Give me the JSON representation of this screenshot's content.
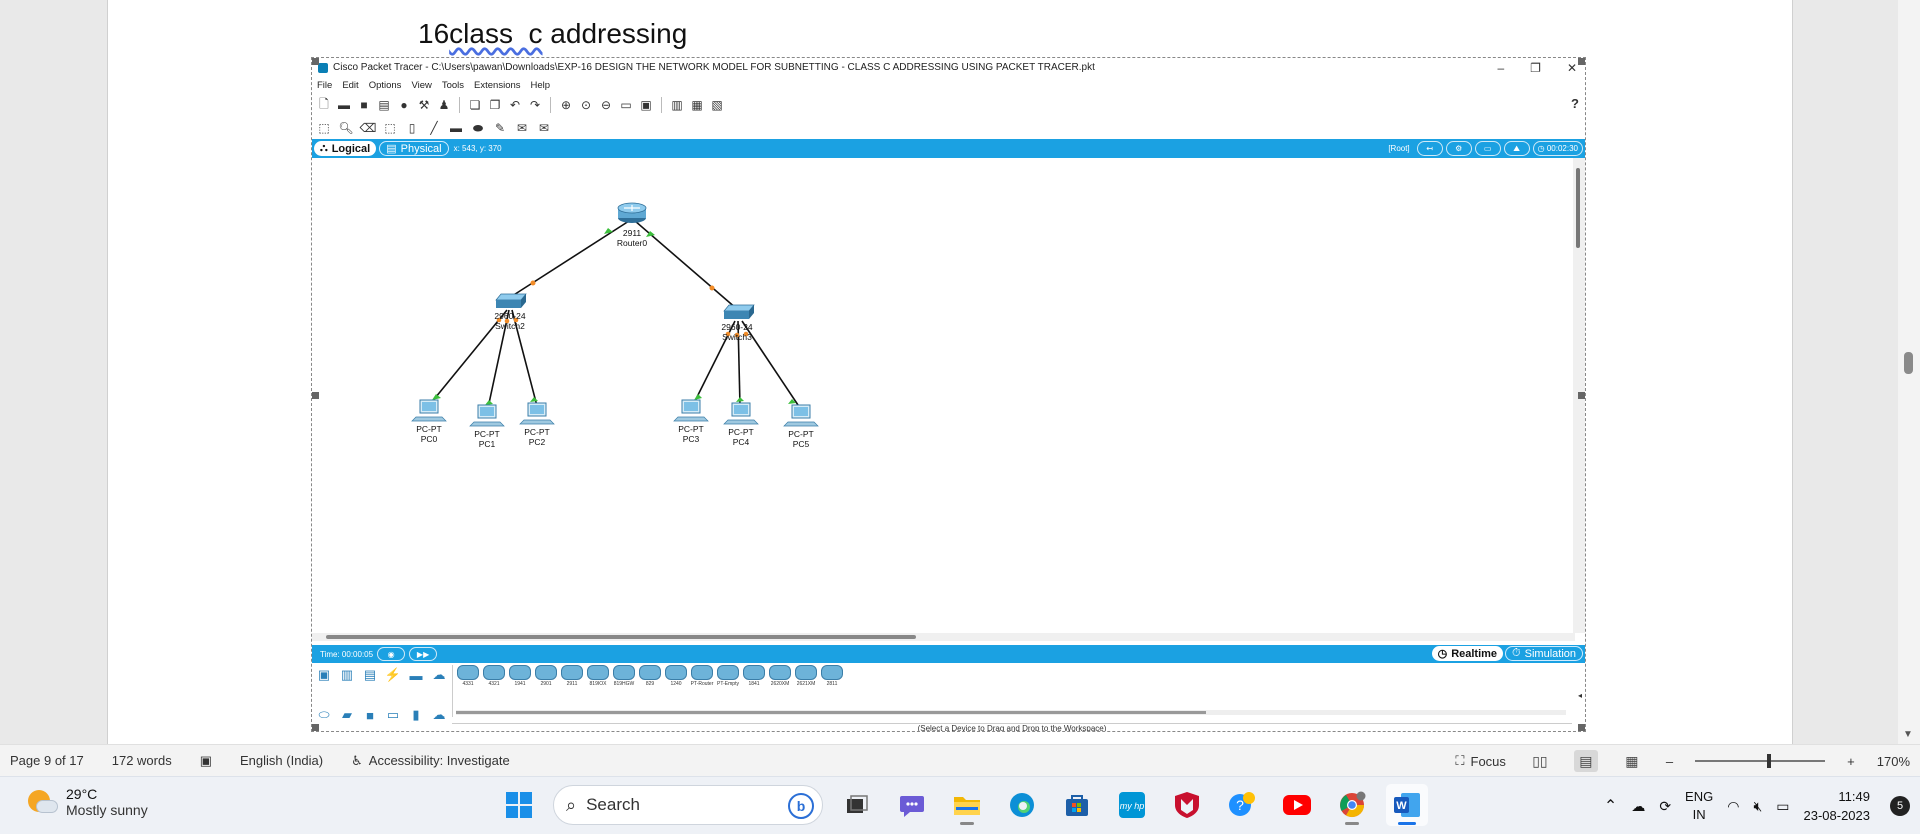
{
  "doc": {
    "heading_prefix": "16",
    "heading_underlined": "class  c",
    "heading_suffix": " addressing"
  },
  "pt": {
    "window_title": "Cisco Packet Tracer - C:\\Users\\pawan\\Downloads\\EXP-16 DESIGN THE NETWORK MODEL FOR SUBNETTING - CLASS C ADDRESSING USING PACKET TRACER.pkt",
    "menu": [
      "File",
      "Edit",
      "Options",
      "View",
      "Tools",
      "Extensions",
      "Help"
    ],
    "help_glyph": "?",
    "modes": {
      "logical": "Logical",
      "physical": "Physical"
    },
    "coords": "x: 543, y: 370",
    "root": "[Root]",
    "clock": "00:02:30",
    "time_label": "Time: 00:00:05",
    "sim_modes": {
      "realtime": "Realtime",
      "simulation": "Simulation"
    },
    "devices_hint": "(Select a Device to Drag and Drop to the Workspace)",
    "device_list": [
      "4331",
      "4321",
      "1941",
      "2901",
      "2911",
      "819IOX",
      "819HGW",
      "829",
      "1240",
      "PT-Router",
      "PT-Empty",
      "1841",
      "2620XM",
      "2621XM",
      "2811"
    ],
    "topology": {
      "router": {
        "model": "2911",
        "name": "Router0"
      },
      "switches": [
        {
          "model": "2960-24",
          "name": "Switch2"
        },
        {
          "model": "2960-24",
          "name": "Switch3"
        }
      ],
      "pcs": [
        {
          "model": "PC-PT",
          "name": "PC0"
        },
        {
          "model": "PC-PT",
          "name": "PC1"
        },
        {
          "model": "PC-PT",
          "name": "PC2"
        },
        {
          "model": "PC-PT",
          "name": "PC3"
        },
        {
          "model": "PC-PT",
          "name": "PC4"
        },
        {
          "model": "PC-PT",
          "name": "PC5"
        }
      ]
    }
  },
  "status": {
    "page": "Page 9 of 17",
    "words": "172 words",
    "language": "English (India)",
    "accessibility": "Accessibility: Investigate",
    "focus": "Focus",
    "zoom": "170%"
  },
  "taskbar": {
    "weather_temp": "29°C",
    "weather_desc": "Mostly sunny",
    "search_placeholder": "Search",
    "lang_line1": "ENG",
    "lang_line2": "IN",
    "time": "11:49",
    "date": "23-08-2023",
    "notifications": "5"
  },
  "colors": {
    "pt_blue": "#1ba1e2",
    "link_green": "#3cbf3c",
    "link_orange": "#f28c28"
  }
}
